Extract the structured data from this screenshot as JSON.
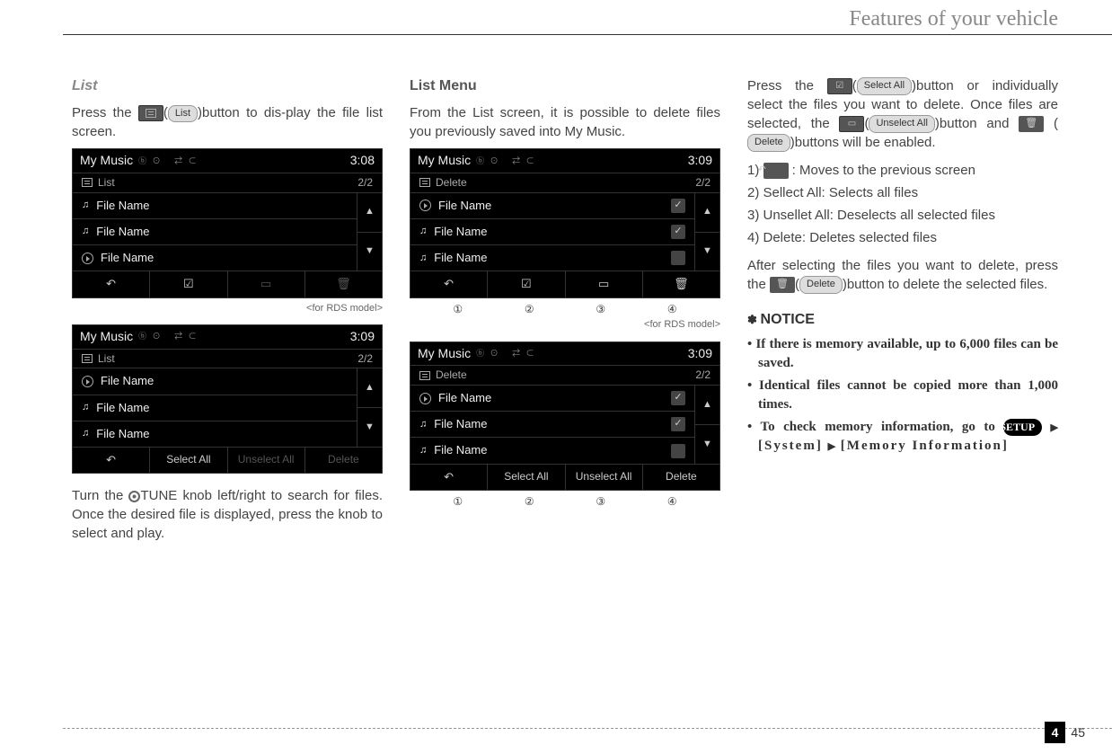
{
  "header": {
    "title": "Features of your vehicle"
  },
  "col1": {
    "heading": "List",
    "p1a": "Press the ",
    "btn_list": "List",
    "p1b": "button to dis-play the file list screen.",
    "caption1": "<for RDS model>",
    "p2": "Turn the ",
    "tune": "TUNE",
    "p2b": " knob left/right to search for files. Once the desired file is displayed, press the knob to select and play."
  },
  "col2": {
    "heading": "List Menu",
    "p1": "From the List screen, it is possible to delete files you previously saved into My Music.",
    "caption1": "<for RDS model>"
  },
  "col3": {
    "p1a": "Press the ",
    "btn_selectall": "Select All",
    "p1b": "button or individually select the files you want to delete. Once files are selected, the ",
    "btn_unselectall": "Unselect All",
    "p1c": "button and ",
    "btn_delete": "Delete",
    "p1d": "buttons will be enabled.",
    "li1a": "1) ",
    "li1b": " : Moves to the previous screen",
    "li2": "2) Sellect All: Selects all files",
    "li3": "3) Unsellet All: Deselects all selected files",
    "li4": "4) Delete: Deletes selected files",
    "p2a": "After selecting the files you want to delete, press the ",
    "btn_delete2": "Delete",
    "p2b": "button to delete the selected files.",
    "notice_title": "NOTICE",
    "n1": "If there is memory available, up to 6,000 files can be saved.",
    "n2": "Identical files cannot be copied more than 1,000 times.",
    "n3a": "To check memory information, go to ",
    "setup": "SETUP",
    "n3b": " [System] ",
    "n3c": " [Memory Information]"
  },
  "ss": {
    "title": "My Music",
    "time1": "3:08",
    "time2": "3:09",
    "sub_list": "List",
    "sub_delete": "Delete",
    "counter": "2/2",
    "filename": "File Name",
    "selectall": "Select All",
    "unselectall": "Unselect All",
    "delete": "Delete"
  },
  "circled": {
    "c1": "①",
    "c2": "②",
    "c3": "③",
    "c4": "④"
  },
  "footer": {
    "chapter": "4",
    "page": "45"
  }
}
